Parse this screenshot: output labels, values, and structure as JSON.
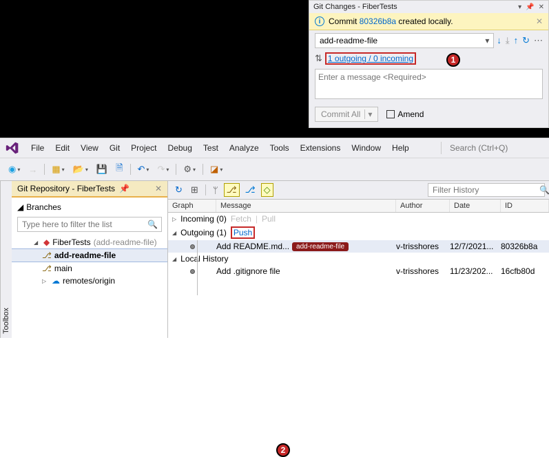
{
  "gitChanges": {
    "title": "Git Changes - FiberTests",
    "info_prefix": "Commit ",
    "info_commit": "80326b8a",
    "info_suffix": " created locally.",
    "branch": "add-readme-file",
    "sync_text": "1 outgoing / 0 incoming",
    "msg_placeholder": "Enter a message <Required>",
    "commit_btn": "Commit All",
    "amend_label": "Amend"
  },
  "callouts": {
    "one": "1",
    "two": "2"
  },
  "menu": {
    "items": [
      "File",
      "Edit",
      "View",
      "Git",
      "Project",
      "Debug",
      "Test",
      "Analyze",
      "Tools",
      "Extensions",
      "Window",
      "Help"
    ],
    "search_placeholder": "Search (Ctrl+Q)"
  },
  "toolbar": {
    "back": "◯",
    "fwd": "→",
    "new": "▦",
    "open": "⧉",
    "save": "💾",
    "saveall": "💾",
    "undo": "↶",
    "redo": "↷"
  },
  "toolbox_label": "Toolbox",
  "repo_tab": "Git Repository - FiberTests",
  "branches": {
    "header": "Branches",
    "filter_placeholder": "Type here to filter the list",
    "repo_name": "FiberTests",
    "repo_branch_suffix": "(add-readme-file)",
    "b1": "add-readme-file",
    "b2": "main",
    "remotes": "remotes/origin"
  },
  "history": {
    "filter_placeholder": "Filter History",
    "headers": {
      "graph": "Graph",
      "msg": "Message",
      "author": "Author",
      "date": "Date",
      "id": "ID"
    },
    "incoming_label": "Incoming (0)",
    "fetch": "Fetch",
    "pull": "Pull",
    "outgoing_label": "Outgoing (1)",
    "push": "Push",
    "local_history": "Local History",
    "rows": [
      {
        "msg": "Add README.md...",
        "badge": "add-readme-file",
        "author": "v-trisshores",
        "date": "12/7/2021...",
        "id": "80326b8a"
      },
      {
        "msg": "Add .gitignore file",
        "badge": "",
        "author": "v-trisshores",
        "date": "11/23/202...",
        "id": "16cfb80d"
      }
    ]
  }
}
